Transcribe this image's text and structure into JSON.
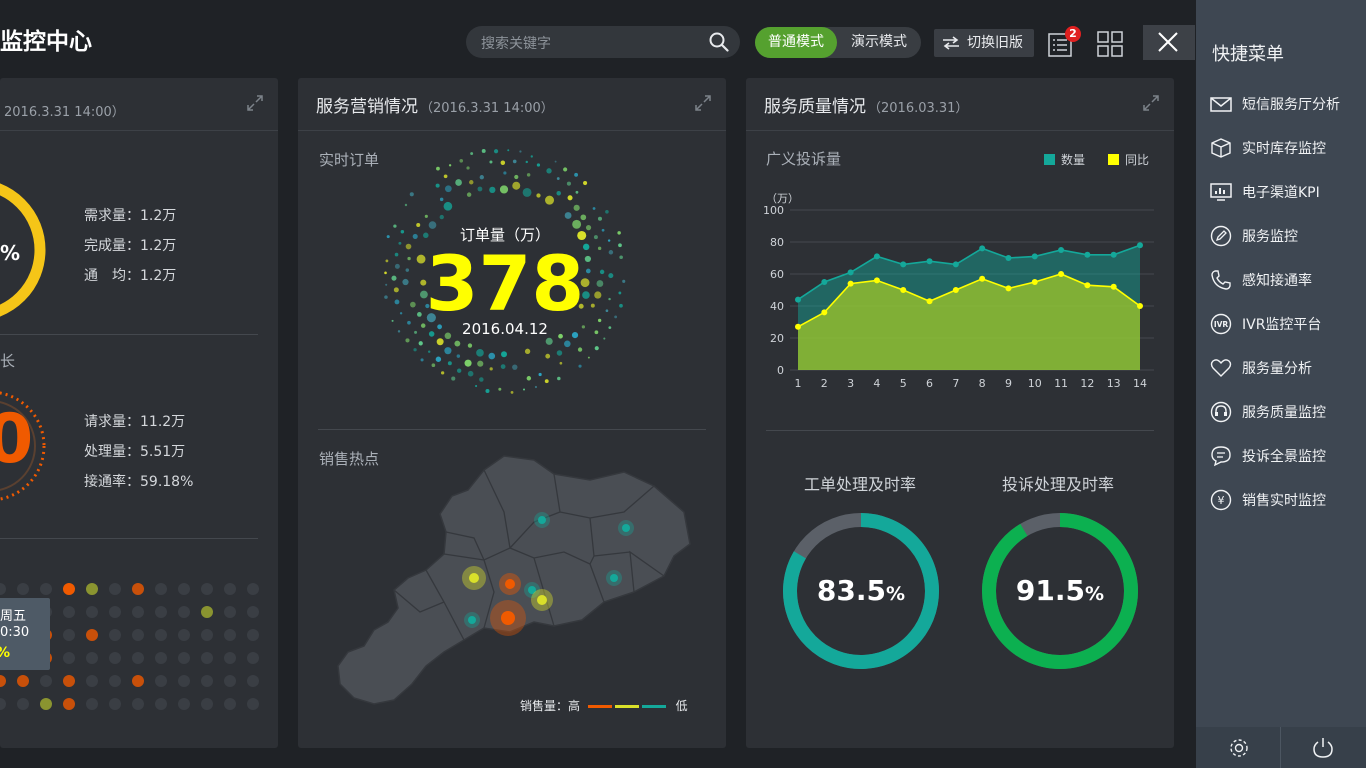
{
  "header": {
    "title": "监控中心",
    "search_placeholder": "搜索关键字",
    "mode_normal": "普通模式",
    "mode_demo": "演示模式",
    "switch_old": "切换旧版",
    "notify_count": "2"
  },
  "panel_left": {
    "time": "2016.3.31 14:00）",
    "gauge1_pct": "%",
    "stat1": "需求量：1.2万",
    "stat2": "完成量：1.2万",
    "stat3": "通　均：1.2万",
    "section2_label": "长",
    "gauge2_digit": "0",
    "stat4": "请求量：11.2万",
    "stat5": "处理量：5.51万",
    "stat6": "接通率：59.18%",
    "tooltip_line1": "周五",
    "tooltip_line2": "0:30",
    "tooltip_line3": "%"
  },
  "panel_mid": {
    "title": "服务营销情况",
    "time": "（2016.3.31 14:00）",
    "realtime_label": "实时订单",
    "order_label": "订单量（万）",
    "order_value": "378",
    "order_date": "2016.04.12",
    "hot_label": "销售热点",
    "legend_prefix": "销售量：高",
    "legend_low": "低"
  },
  "panel_right": {
    "title": "服务质量情况",
    "time": "（2016.03.31）",
    "chart_title": "广义投诉量",
    "unit": "（万）",
    "legend_count": "数量",
    "legend_yoy": "同比",
    "donut1_title": "工单处理及时率",
    "donut1_value": "83.5",
    "donut1_unit": "%",
    "donut2_title": "投诉处理及时率",
    "donut2_value": "91.5",
    "donut2_unit": "%"
  },
  "sidebar": {
    "title": "快捷菜单",
    "items": [
      {
        "label": "短信服务厅分析",
        "icon": "mail-icon"
      },
      {
        "label": "实时库存监控",
        "icon": "box-icon"
      },
      {
        "label": "电子渠道KPI",
        "icon": "monitor-chart-icon"
      },
      {
        "label": "服务监控",
        "icon": "edit-circle-icon"
      },
      {
        "label": "感知接通率",
        "icon": "phone-icon"
      },
      {
        "label": "IVR监控平台",
        "icon": "ivr-icon"
      },
      {
        "label": "服务量分析",
        "icon": "heart-icon"
      },
      {
        "label": "服务质量监控",
        "icon": "headset-icon"
      },
      {
        "label": "投诉全景监控",
        "icon": "chat-icon"
      },
      {
        "label": "销售实时监控",
        "icon": "yen-icon"
      }
    ]
  },
  "colors": {
    "accent_green": "#55a12f",
    "teal": "#14a89a",
    "yellow": "#ffff00",
    "orange": "#f05a00",
    "donut_green": "#0cb050",
    "gauge_yellow": "#f5c518"
  },
  "chart_data": [
    {
      "type": "area",
      "title": "广义投诉量",
      "ylabel": "（万）",
      "x": [
        1,
        2,
        3,
        4,
        5,
        6,
        7,
        8,
        9,
        10,
        11,
        12,
        13,
        14
      ],
      "ylim": [
        0,
        100
      ],
      "yticks": [
        0,
        20,
        40,
        60,
        80,
        100
      ],
      "series": [
        {
          "name": "数量",
          "color": "#14a89a",
          "values": [
            44,
            55,
            61,
            71,
            66,
            68,
            66,
            76,
            70,
            71,
            75,
            72,
            72,
            78
          ]
        },
        {
          "name": "同比",
          "color": "#ffff00",
          "values": [
            27,
            36,
            54,
            56,
            50,
            43,
            50,
            57,
            51,
            55,
            60,
            53,
            52,
            40
          ]
        }
      ],
      "legend": "top-right",
      "grid": true
    },
    {
      "type": "pie",
      "title": "工单处理及时率",
      "values": [
        83.5,
        16.5
      ],
      "center_label": "83.5%"
    },
    {
      "type": "pie",
      "title": "投诉处理及时率",
      "values": [
        91.5,
        8.5
      ],
      "center_label": "91.5%"
    }
  ]
}
